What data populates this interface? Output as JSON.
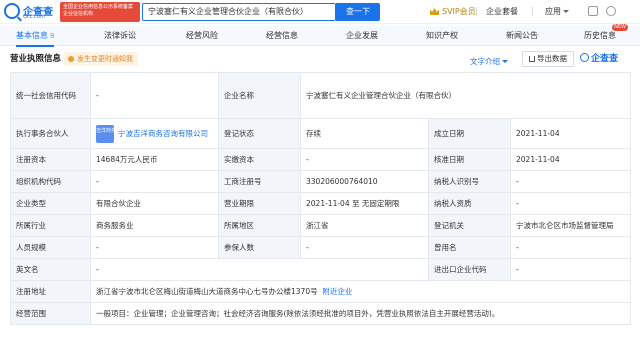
{
  "header": {
    "logo_name": "企查查",
    "logo_domain": "Qcc.com",
    "red_badge": "全国企业信用信息公示系统备案企业征信机构",
    "search_value": "宁波塞仁有义企业管理合伙企业（有限合伙）",
    "search_button": "查一下",
    "svip_label": "SVIP会员",
    "nav": [
      "企业套餐",
      "应用"
    ]
  },
  "tabs": [
    {
      "label": "基本信息",
      "count": "8",
      "active": true
    },
    {
      "label": "法律诉讼"
    },
    {
      "label": "经营风险"
    },
    {
      "label": "经营信息"
    },
    {
      "label": "企业发展"
    },
    {
      "label": "知识产权"
    },
    {
      "label": "新闻公告"
    },
    {
      "label": "历史信息",
      "badge": "NEW"
    }
  ],
  "section": {
    "title": "营业执照信息",
    "warning": "发生变更时通知我",
    "text_intro": "文字介绍",
    "export": "导出数据",
    "watermark": "企查查"
  },
  "table": {
    "row1": {
      "l1": "统一社会信用代码",
      "v1": "-",
      "l2": "企业名称",
      "v2": "宁波塞仁有义企业管理合伙企业（有限合伙）"
    },
    "row2": {
      "l1": "执行事务合伙人",
      "rep_logo": "吉洋商务",
      "v1": "宁波吉洋商务咨询有限公司",
      "l2": "登记状态",
      "v2": "存续",
      "l3": "成立日期",
      "v3": "2021-11-04"
    },
    "row3": {
      "l1": "注册资本",
      "v1": "14684万元人民币",
      "l2": "实缴资本",
      "v2": "-",
      "l3": "核准日期",
      "v3": "2021-11-04"
    },
    "row4": {
      "l1": "组织机构代码",
      "v1": "-",
      "l2": "工商注册号",
      "v2": "330206000764010",
      "l3": "纳税人识别号",
      "v3": "-"
    },
    "row5": {
      "l1": "企业类型",
      "v1": "有限合伙企业",
      "l2": "营业期限",
      "v2": "2021-11-04 至 无固定期限",
      "l3": "纳税人资质",
      "v3": "-"
    },
    "row6": {
      "l1": "所属行业",
      "v1": "商务服务业",
      "l2": "所属地区",
      "v2": "浙江省",
      "l3": "登记机关",
      "v3": "宁波市北仑区市场监督管理局"
    },
    "row7": {
      "l1": "人员规模",
      "v1": "-",
      "l2": "参保人数",
      "v2": "-",
      "l3": "曾用名",
      "v3": "-"
    },
    "row8": {
      "l1": "英文名",
      "v1": "-",
      "l2": "进出口企业代码",
      "v2": "-"
    },
    "row9": {
      "l1": "注册地址",
      "v1": "浙江省宁波市北仑区梅山街道梅山大道商务中心七号办公楼1370号",
      "link": "附近企业"
    },
    "row10": {
      "l1": "经营范围",
      "v1": "一般项目：企业管理；企业管理咨询；社会经济咨询服务(除依法须经批准的项目外，凭营业执照依法自主开展经营活动)。"
    }
  },
  "colors": {
    "accent": "#1a73e8",
    "warn": "#e6851f",
    "label_bg": "#f2f6fb"
  }
}
